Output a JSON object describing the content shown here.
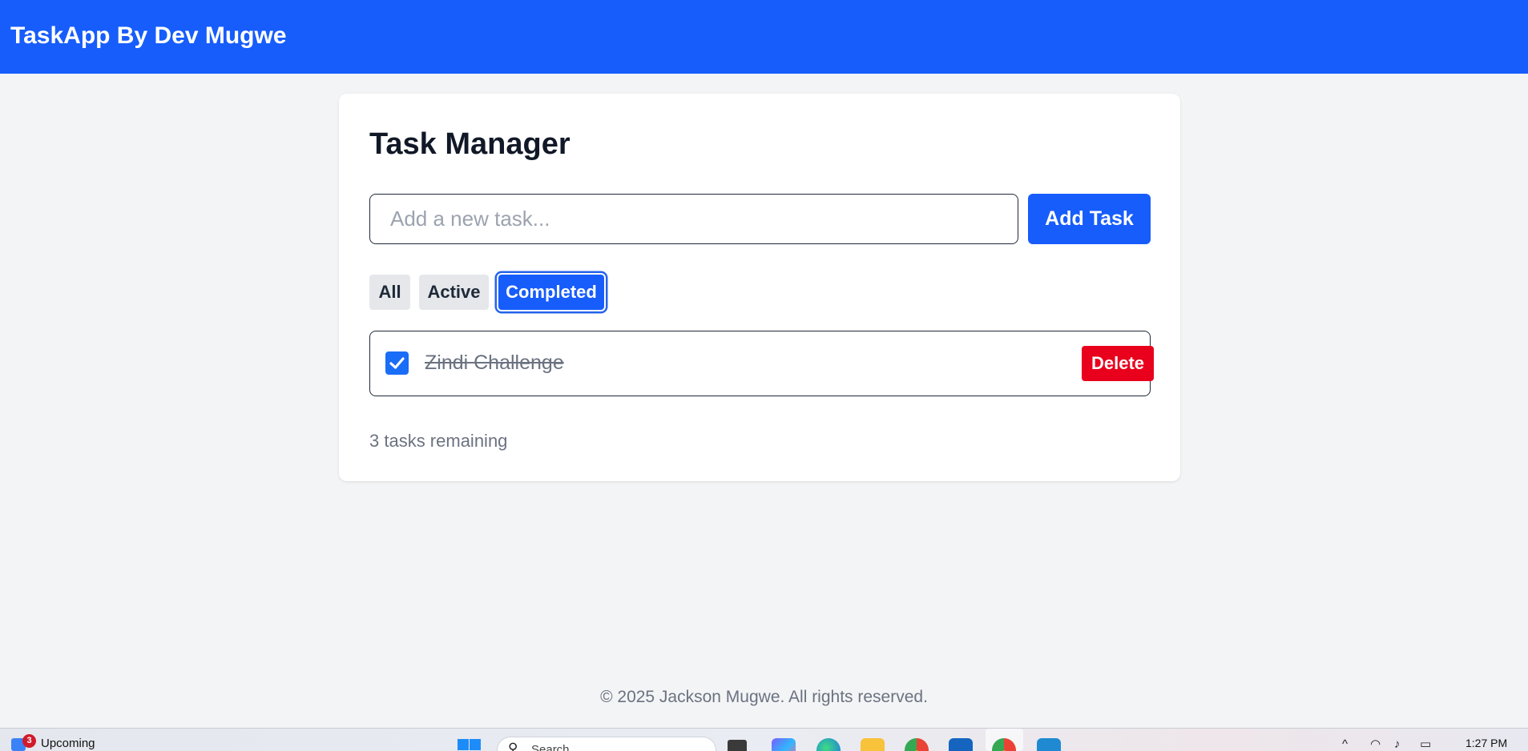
{
  "header": {
    "brand": "TaskApp By Dev Mugwe"
  },
  "main": {
    "title": "Task Manager",
    "input": {
      "placeholder": "Add a new task...",
      "value": ""
    },
    "add_button": "Add Task",
    "filters": [
      {
        "label": "All",
        "selected": false
      },
      {
        "label": "Active",
        "selected": false
      },
      {
        "label": "Completed",
        "selected": true
      }
    ],
    "tasks": [
      {
        "text": "Zindi Challenge",
        "completed": true,
        "delete_label": "Delete"
      }
    ],
    "remaining": "3 tasks remaining"
  },
  "footer": {
    "text": "© 2025 Jackson Mugwe. All rights reserved."
  },
  "taskbar": {
    "widget_badge": "3",
    "widget_label": "Upcoming",
    "search_placeholder": "Search",
    "time": "1:27 PM"
  },
  "colors": {
    "accent": "#175dfb",
    "danger": "#e8001c",
    "background": "#f3f4f6"
  }
}
